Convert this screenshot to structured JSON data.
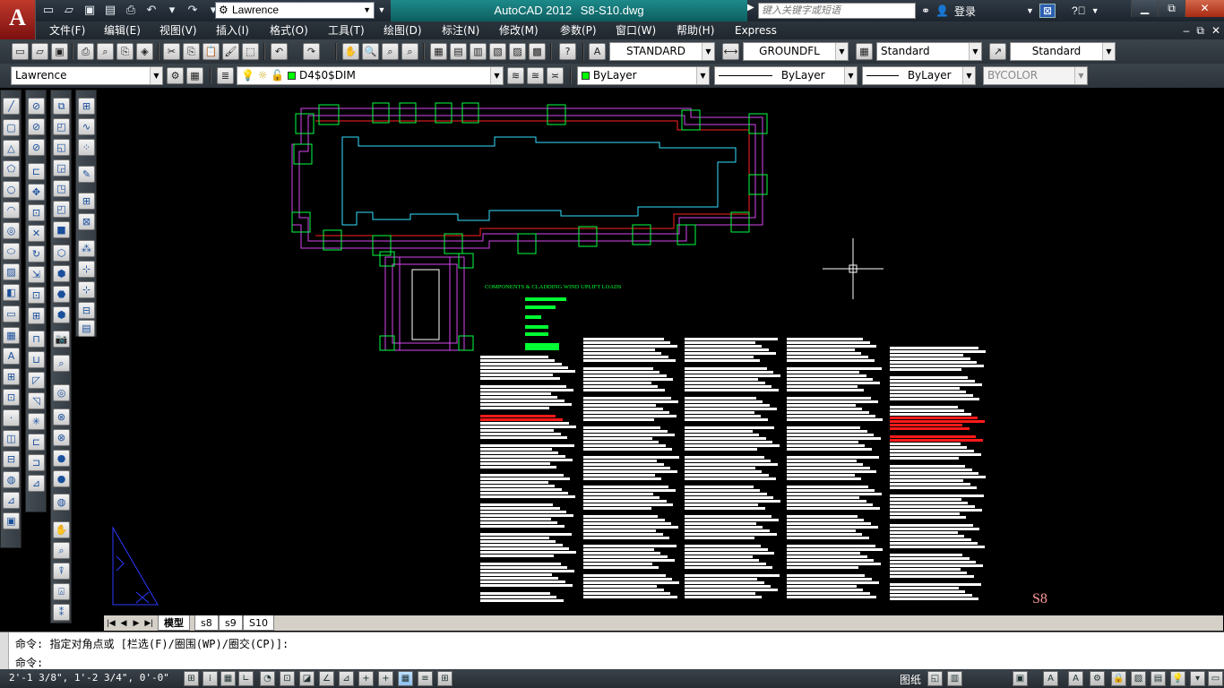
{
  "app": {
    "logo_letter": "A",
    "name": "AutoCAD 2012",
    "file": "S8-S10.dwg",
    "workspace": "Lawrence",
    "search_placeholder": "键入关键字或短语",
    "login": "登录",
    "accent": "#1d8a8a"
  },
  "menu": [
    "文件(F)",
    "编辑(E)",
    "视图(V)",
    "插入(I)",
    "格式(O)",
    "工具(T)",
    "绘图(D)",
    "标注(N)",
    "修改(M)",
    "参数(P)",
    "窗口(W)",
    "帮助(H)",
    "Express"
  ],
  "styles": {
    "text_style": "STANDARD",
    "dim_style": "GROUNDFL",
    "table_style": "Standard",
    "mleader_style": "Standard"
  },
  "layers": {
    "workspace": "Lawrence",
    "current_layer": "D4$0$DIM",
    "color": "ByLayer",
    "linetype": "ByLayer",
    "lineweight": "ByLayer",
    "plotstyle": "BYCOLOR"
  },
  "drawing": {
    "note_title": "COMPONENTS & CLADDING WIND UPLIFT LOADS",
    "sheet_label": "S8"
  },
  "tabs": [
    "模型",
    "s8",
    "s9",
    "S10"
  ],
  "command": {
    "history": "命令: 指定对角点或 [栏选(F)/圈围(WP)/圈交(CP)]:",
    "prompt": "命令:"
  },
  "status": {
    "coordinates": "2'-1 3/8\", 1'-2 3/4\", 0'-0\"",
    "paper": "图纸"
  }
}
